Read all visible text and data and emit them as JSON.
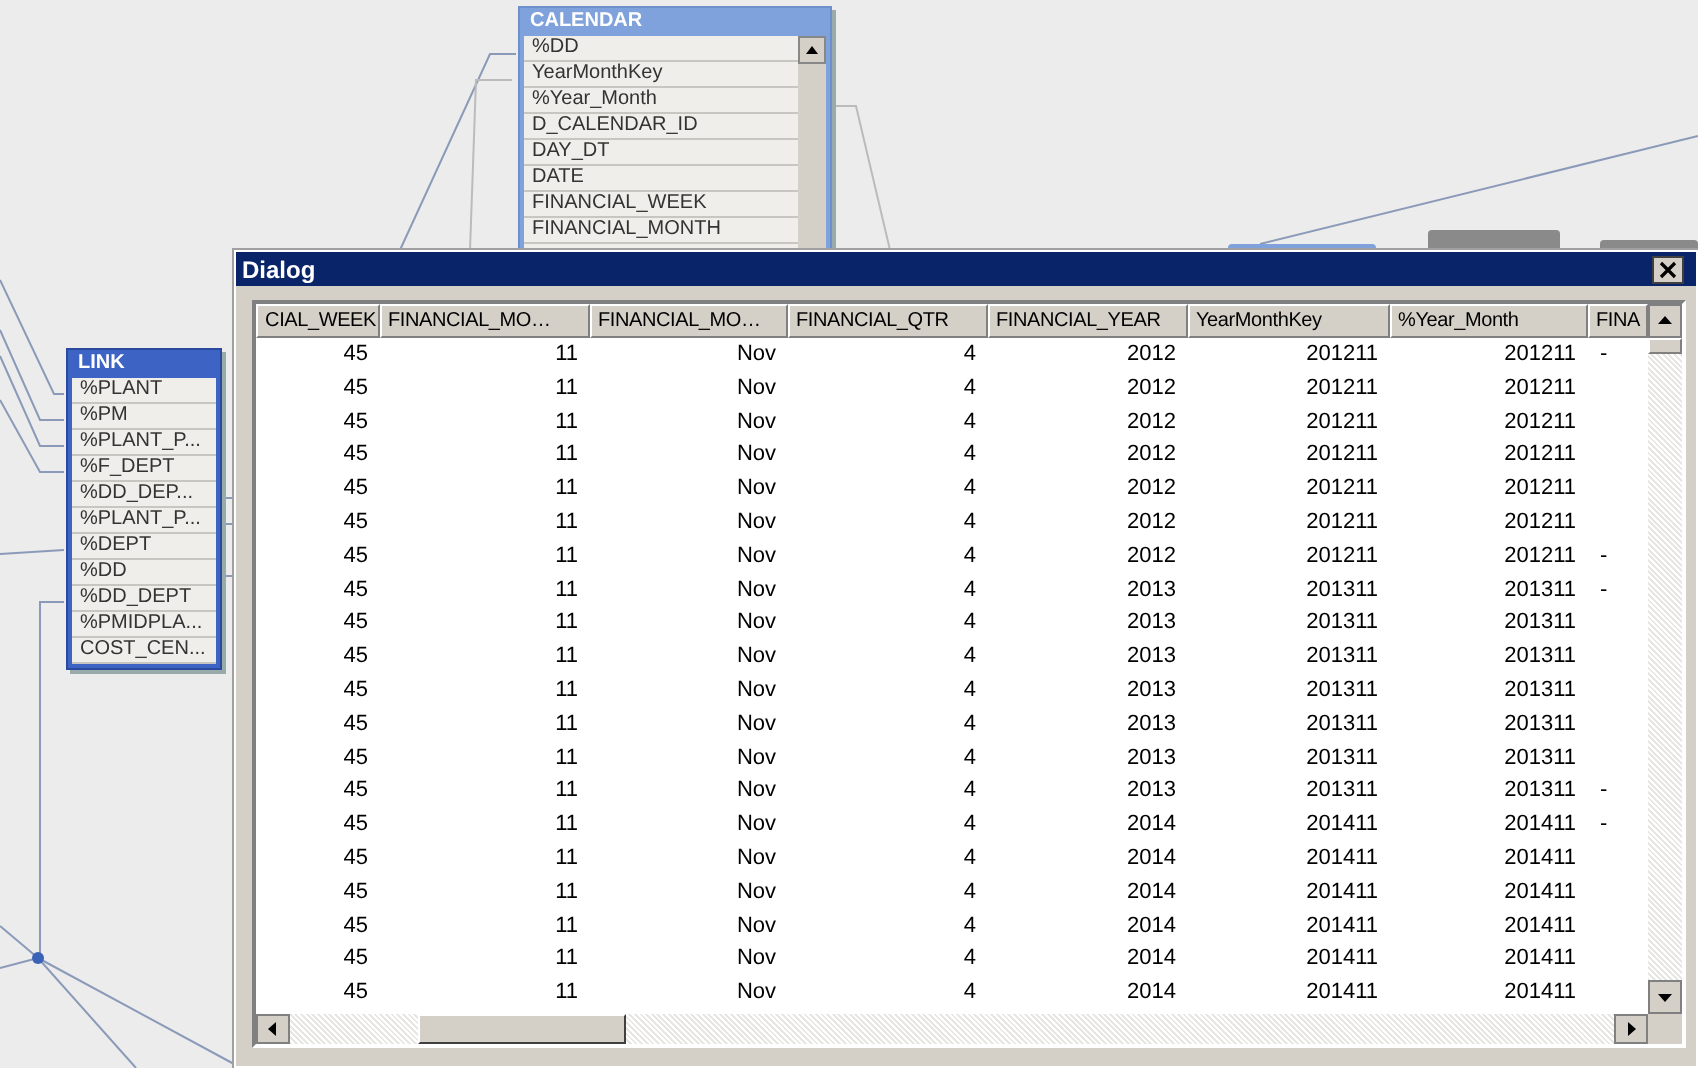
{
  "calendar_table": {
    "title": "CALENDAR",
    "fields": [
      "%DD",
      "YearMonthKey",
      "%Year_Month",
      "D_CALENDAR_ID",
      "DAY_DT",
      "DATE",
      "FINANCIAL_WEEK",
      "FINANCIAL_MONTH"
    ]
  },
  "link_table": {
    "title": "LINK",
    "fields": [
      "%PLANT",
      "%PM",
      "%PLANT_P...",
      "%F_DEPT",
      "%DD_DEP...",
      "%PLANT_P...",
      "%DEPT",
      "%DD",
      "%DD_DEPT",
      "%PMIDPLA...",
      "COST_CEN..."
    ]
  },
  "dialog": {
    "title": "Dialog",
    "columns": [
      "CIAL_WEEK",
      "FINANCIAL_MO…",
      "FINANCIAL_MO…",
      "FINANCIAL_QTR",
      "FINANCIAL_YEAR",
      "YearMonthKey",
      "%Year_Month",
      "FINA"
    ],
    "rows": [
      [
        "45",
        "11",
        "Nov",
        "4",
        "2012",
        "201211",
        "201211",
        "-"
      ],
      [
        "45",
        "11",
        "Nov",
        "4",
        "2012",
        "201211",
        "201211"
      ],
      [
        "45",
        "11",
        "Nov",
        "4",
        "2012",
        "201211",
        "201211"
      ],
      [
        "45",
        "11",
        "Nov",
        "4",
        "2012",
        "201211",
        "201211"
      ],
      [
        "45",
        "11",
        "Nov",
        "4",
        "2012",
        "201211",
        "201211"
      ],
      [
        "45",
        "11",
        "Nov",
        "4",
        "2012",
        "201211",
        "201211"
      ],
      [
        "45",
        "11",
        "Nov",
        "4",
        "2012",
        "201211",
        "201211",
        "-"
      ],
      [
        "45",
        "11",
        "Nov",
        "4",
        "2013",
        "201311",
        "201311",
        "-"
      ],
      [
        "45",
        "11",
        "Nov",
        "4",
        "2013",
        "201311",
        "201311"
      ],
      [
        "45",
        "11",
        "Nov",
        "4",
        "2013",
        "201311",
        "201311"
      ],
      [
        "45",
        "11",
        "Nov",
        "4",
        "2013",
        "201311",
        "201311"
      ],
      [
        "45",
        "11",
        "Nov",
        "4",
        "2013",
        "201311",
        "201311"
      ],
      [
        "45",
        "11",
        "Nov",
        "4",
        "2013",
        "201311",
        "201311"
      ],
      [
        "45",
        "11",
        "Nov",
        "4",
        "2013",
        "201311",
        "201311",
        "-"
      ],
      [
        "45",
        "11",
        "Nov",
        "4",
        "2014",
        "201411",
        "201411",
        "-"
      ],
      [
        "45",
        "11",
        "Nov",
        "4",
        "2014",
        "201411",
        "201411"
      ],
      [
        "45",
        "11",
        "Nov",
        "4",
        "2014",
        "201411",
        "201411"
      ],
      [
        "45",
        "11",
        "Nov",
        "4",
        "2014",
        "201411",
        "201411"
      ],
      [
        "45",
        "11",
        "Nov",
        "4",
        "2014",
        "201411",
        "201411"
      ],
      [
        "45",
        "11",
        "Nov",
        "4",
        "2014",
        "201411",
        "201411"
      ]
    ]
  }
}
